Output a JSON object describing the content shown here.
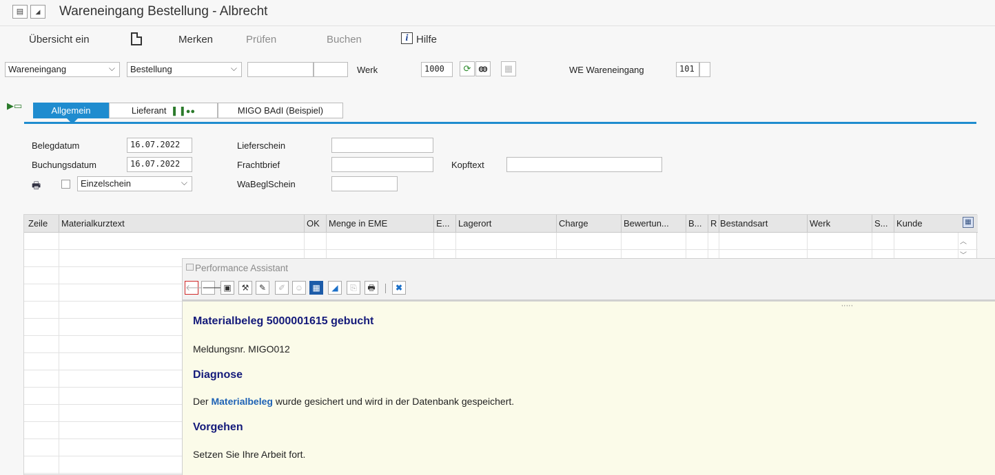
{
  "window": {
    "title": "Wareneingang Bestellung - Albrecht"
  },
  "toolbar": {
    "overview": "Übersicht ein",
    "merken": "Merken",
    "pruefen": "Prüfen",
    "buchen": "Buchen",
    "hilfe": "Hilfe"
  },
  "selection": {
    "action": "Wareneingang",
    "reference": "Bestellung",
    "ref_field1": "",
    "ref_field2": "",
    "werk_label": "Werk",
    "werk_value": "1000",
    "movement_label": "WE Wareneingang",
    "movement_value": "101",
    "movement_extra": ""
  },
  "tabs": [
    {
      "label": "Allgemein",
      "active": true
    },
    {
      "label": "Lieferant",
      "active": false
    },
    {
      "label": "MIGO BAdI (Beispiel)",
      "active": false
    }
  ],
  "header": {
    "belegdatum_label": "Belegdatum",
    "belegdatum": "16.07.2022",
    "buchungsdatum_label": "Buchungsdatum",
    "buchungsdatum": "16.07.2022",
    "print_option": "Einzelschein",
    "lieferschein_label": "Lieferschein",
    "lieferschein": "",
    "frachtbrief_label": "Frachtbrief",
    "frachtbrief": "",
    "wabegl_label": "WaBeglSchein",
    "wabegl": "",
    "kopftext_label": "Kopftext",
    "kopftext": ""
  },
  "grid": {
    "columns": [
      "Zeile",
      "Materialkurztext",
      "OK",
      "Menge in EME",
      "E...",
      "Lagerort",
      "Charge",
      "Bewertun...",
      "B...",
      "R",
      "Bestandsart",
      "Werk",
      "S...",
      "Kunde"
    ],
    "rows": []
  },
  "assistant": {
    "title": "Performance Assistant",
    "heading": "Materialbeleg 5000001615 gebucht",
    "message_no": "Meldungsnr. MIGO012",
    "diagnose_heading": "Diagnose",
    "diagnose_pre": "Der ",
    "diagnose_link": "Materialbeleg",
    "diagnose_post": " wurde gesichert und wird in der Datenbank gespeichert.",
    "vorgehen_heading": "Vorgehen",
    "vorgehen_text": "Setzen Sie Ihre Arbeit fort."
  },
  "colors": {
    "accent": "#1f8ccf",
    "assistant_bg": "#fbfbe9",
    "heading": "#141a7a",
    "link": "#1e62b5"
  }
}
